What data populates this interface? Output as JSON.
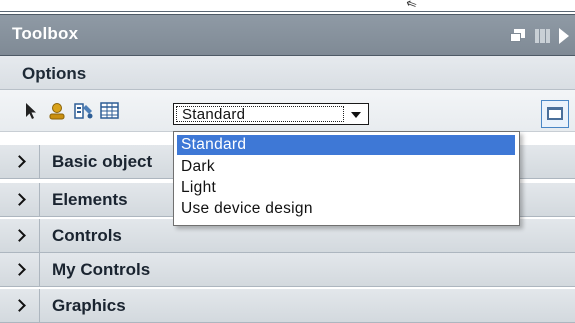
{
  "panel": {
    "title": "Toolbox",
    "options_label": "Options"
  },
  "icons": {
    "float": "float-window-icon",
    "columns": "columns-icon",
    "expand": "expand-arrow-icon",
    "select": "pointer-arrow-icon",
    "person": "person-icon",
    "properties": "properties-icon",
    "table": "table-icon",
    "view": "view-window-icon"
  },
  "design_select": {
    "value": "Standard",
    "options": [
      "Standard",
      "Dark",
      "Light",
      "Use device design"
    ]
  },
  "categories": [
    "Basic object",
    "Elements",
    "Controls",
    "My Controls",
    "Graphics"
  ],
  "colors": {
    "titlebar": "#8f9aa5",
    "selection": "#3e78d6"
  }
}
